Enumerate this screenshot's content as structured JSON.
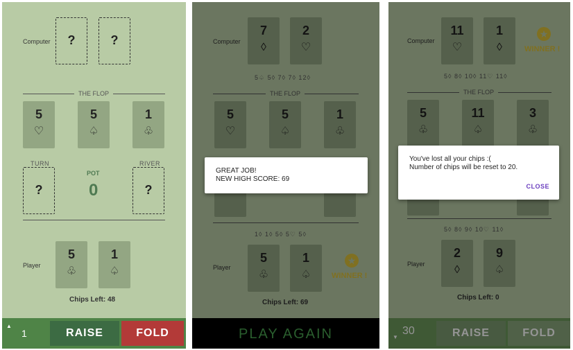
{
  "labels": {
    "computer": "Computer",
    "player": "Player",
    "flop": "THE FLOP",
    "turn": "TURN",
    "river": "RIVER",
    "pot": "POT"
  },
  "screen1": {
    "computer_cards": [
      {
        "rank": "?",
        "suit": ""
      },
      {
        "rank": "?",
        "suit": ""
      }
    ],
    "flop": [
      {
        "rank": "5",
        "suit": "♡"
      },
      {
        "rank": "5",
        "suit": "♤"
      },
      {
        "rank": "1",
        "suit": "♧"
      }
    ],
    "turn": {
      "rank": "?",
      "suit": ""
    },
    "river": {
      "rank": "?",
      "suit": ""
    },
    "pot": "0",
    "player_cards": [
      {
        "rank": "5",
        "suit": "♧"
      },
      {
        "rank": "1",
        "suit": "♤"
      }
    ],
    "chips_left": "Chips Left: 48",
    "bet_caret": "▲",
    "bet_value": "1",
    "raise_label": "RAISE",
    "fold_label": "FOLD"
  },
  "screen2": {
    "computer_cards": [
      {
        "rank": "7",
        "suit": "◊"
      },
      {
        "rank": "2",
        "suit": "♡"
      }
    ],
    "computer_history": "5♤  5◊  7◊  7◊  12◊",
    "flop": [
      {
        "rank": "5",
        "suit": "♡"
      },
      {
        "rank": "5",
        "suit": "♤"
      },
      {
        "rank": "1",
        "suit": "♧"
      }
    ],
    "turn": {
      "rank": "",
      "suit": "♧"
    },
    "river": {
      "rank": "",
      "suit": "♤"
    },
    "player_history": "1◊  1◊  5◊  5♡  5◊",
    "player_cards": [
      {
        "rank": "5",
        "suit": "♧"
      },
      {
        "rank": "1",
        "suit": "♤"
      }
    ],
    "chips_left": "Chips Left: 69",
    "winner_text": "WINNER !",
    "dialog": {
      "line1": "GREAT JOB!",
      "line2": "NEW HIGH SCORE: 69"
    },
    "play_again": "PLAY AGAIN"
  },
  "screen3": {
    "computer_cards": [
      {
        "rank": "11",
        "suit": "♡"
      },
      {
        "rank": "1",
        "suit": "◊"
      }
    ],
    "computer_history": "5◊  8◊  10◊  11♡  11◊",
    "winner_text": "WINNER !",
    "flop": [
      {
        "rank": "5",
        "suit": "♧"
      },
      {
        "rank": "11",
        "suit": "♤"
      },
      {
        "rank": "3",
        "suit": "♧"
      }
    ],
    "turn": {
      "rank": "",
      "suit": "◊"
    },
    "river": {
      "rank": "",
      "suit": "♤"
    },
    "player_history": "5◊  8◊  9◊  10♡  11◊",
    "player_cards": [
      {
        "rank": "2",
        "suit": "◊"
      },
      {
        "rank": "9",
        "suit": "♤"
      }
    ],
    "chips_left": "Chips Left: 0",
    "dialog": {
      "line1": "You've lost all your chips :(",
      "line2": "Number of chips will be reset to 20.",
      "close": "CLOSE"
    },
    "bet_caret": "▼",
    "bet_value": "30",
    "raise_label": "RAISE",
    "fold_label": "FOLD"
  }
}
